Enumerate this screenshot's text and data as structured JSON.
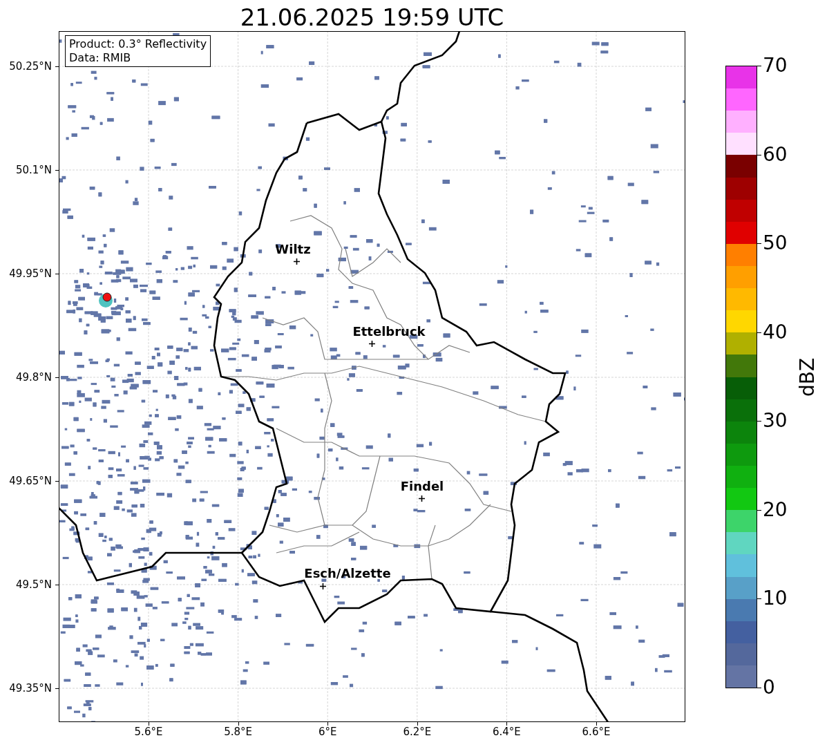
{
  "title": "21.06.2025 19:59 UTC",
  "info_box": {
    "lines": [
      "Product: 0.3° Reflectivity",
      "Data: RMIB"
    ]
  },
  "places": [
    {
      "name": "Wiltz"
    },
    {
      "name": "Ettelbruck"
    },
    {
      "name": "Findel"
    },
    {
      "name": "Esch/Alzette"
    }
  ],
  "y_ticks": [
    "50.25°N",
    "50.1°N",
    "49.95°N",
    "49.8°N",
    "49.65°N",
    "49.5°N",
    "49.35°N"
  ],
  "x_ticks": [
    "5.6°E",
    "5.8°E",
    "6°E",
    "6.2°E",
    "6.4°E",
    "6.6°E"
  ],
  "colorbar": {
    "label": "dBZ",
    "ticks": [
      "70",
      "60",
      "50",
      "40",
      "30",
      "20",
      "10",
      "0"
    ],
    "segments": [
      {
        "color": "#e833e8"
      },
      {
        "color": "#ff66ff"
      },
      {
        "color": "#ffb0ff"
      },
      {
        "color": "#ffe0ff"
      },
      {
        "color": "#7a0000"
      },
      {
        "color": "#9e0000"
      },
      {
        "color": "#c00000"
      },
      {
        "color": "#e00000"
      },
      {
        "color": "#ff7f00"
      },
      {
        "color": "#ff9f00"
      },
      {
        "color": "#ffb900"
      },
      {
        "color": "#ffd700"
      },
      {
        "color": "#b0b000"
      },
      {
        "color": "#42780a"
      },
      {
        "color": "#075e07"
      },
      {
        "color": "#0a700a"
      },
      {
        "color": "#0c840c"
      },
      {
        "color": "#0e9a0e"
      },
      {
        "color": "#10b010"
      },
      {
        "color": "#12c812"
      },
      {
        "color": "#3dd46a"
      },
      {
        "color": "#60d6c0"
      },
      {
        "color": "#60c0dc"
      },
      {
        "color": "#58a0c8"
      },
      {
        "color": "#4a7ab0"
      },
      {
        "color": "#4460a0"
      },
      {
        "color": "#54689c"
      },
      {
        "color": "#6474a4"
      }
    ]
  }
}
